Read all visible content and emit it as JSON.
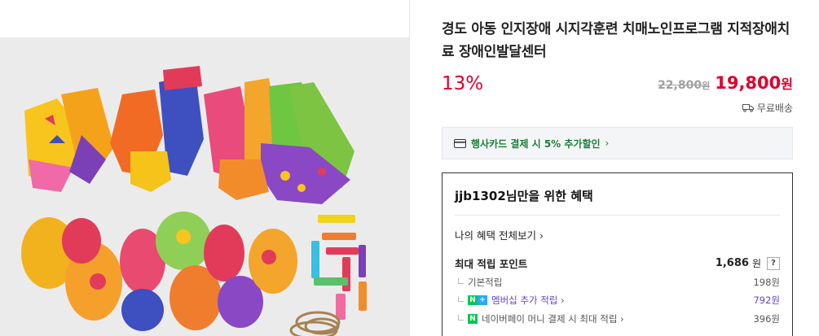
{
  "product": {
    "title": "경도 아동 인지장애 시지각훈련 치매노인프로그램 지적장애치료 장애인발달센터",
    "discount": "13%",
    "original_price": "22,800",
    "original_unit": "원",
    "sale_price": "19,800",
    "sale_unit": "원",
    "shipping": "무료배송"
  },
  "card_banner": {
    "text": "행사카드 결제 시 5% 추가할인",
    "arrow": "›"
  },
  "benefits": {
    "title": "jjb1302님만을 위한 혜택",
    "all_link": "나의 혜택 전체보기",
    "max_label": "최대 적립 포인트",
    "max_value": "1,686",
    "max_unit": "원",
    "help": "?",
    "rows": [
      {
        "label": "기본적립",
        "value": "198원"
      },
      {
        "label": "멤버십 추가 적립",
        "value": "792원"
      },
      {
        "label": "네이버페이 머니 결제 시 최대 적립",
        "value": "396원"
      }
    ]
  },
  "colors": {
    "accent_red": "#e0002a",
    "card_green": "#1a7f37",
    "naver_green": "#03c75a",
    "membership_purple": "#6940c9"
  }
}
